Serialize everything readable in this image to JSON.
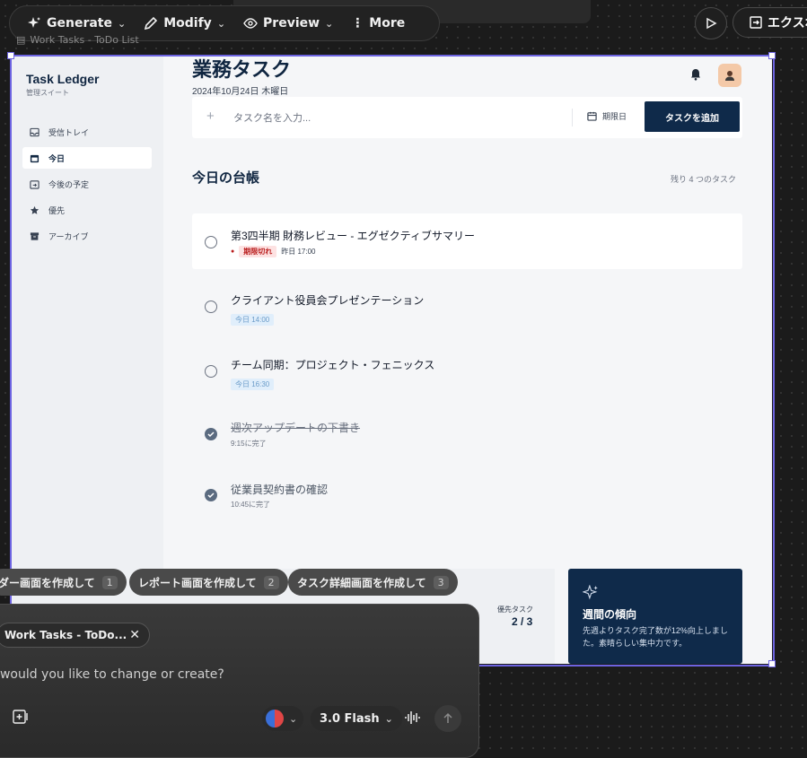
{
  "toolbar": {
    "generate": "Generate",
    "modify": "Modify",
    "preview": "Preview",
    "more": "More",
    "export": "エクスポ"
  },
  "frame_label": "Work Tasks - ToDo List",
  "app": {
    "brand": "Task Ledger",
    "brand_sub": "管理スイート",
    "nav": [
      {
        "label": "受信トレイ",
        "icon": "inbox-icon"
      },
      {
        "label": "今日",
        "icon": "calendar-icon",
        "active": true
      },
      {
        "label": "今後の予定",
        "icon": "calendar-arrow-icon"
      },
      {
        "label": "優先",
        "icon": "star-icon"
      },
      {
        "label": "アーカイブ",
        "icon": "archive-icon"
      }
    ],
    "title": "業務タスク",
    "date": "2024年10月24日 木曜日",
    "add": {
      "placeholder": "タスク名を入力...",
      "due_label": "期限日",
      "button": "タスクを追加"
    },
    "section_title": "今日の台帳",
    "remaining": "残り 4 つのタスク",
    "tasks": [
      {
        "title": "第3四半期 財務レビュー - エグゼクティブサマリー",
        "badge": "期限切れ",
        "meta": "昨日 17:00",
        "done": false
      },
      {
        "title": "クライアント役員会プレゼンテーション",
        "meta": "今日 14:00",
        "done": false
      },
      {
        "title": "チーム同期：プロジェクト・フェニックス",
        "meta": "今日 16:30",
        "done": false
      },
      {
        "title": "週次アップデートの下書き",
        "meta": "9:15に完了",
        "done": true
      },
      {
        "title": "従業員契約書の確認",
        "meta": "10:45に完了",
        "done": true
      }
    ],
    "priority_label": "優先タスク",
    "priority_value": "2 / 3",
    "trend": {
      "title": "週間の傾向",
      "desc": "先週よりタスク完了数が12%向上しました。素晴らしい集中力です。"
    }
  },
  "chips": [
    {
      "label": "ダー画面を作成して",
      "num": "1"
    },
    {
      "label": "レポート画面を作成して",
      "num": "2"
    },
    {
      "label": "タスク詳細画面を作成して",
      "num": "3"
    }
  ],
  "chat": {
    "file_pill": "Work Tasks - ToDo...",
    "placeholder": "t would you like to change or create?",
    "model": "3.0 Flash"
  },
  "colors": {
    "accent": "#6c63e0",
    "navy": "#0f2a4a",
    "overdue": "#b91c1c"
  }
}
